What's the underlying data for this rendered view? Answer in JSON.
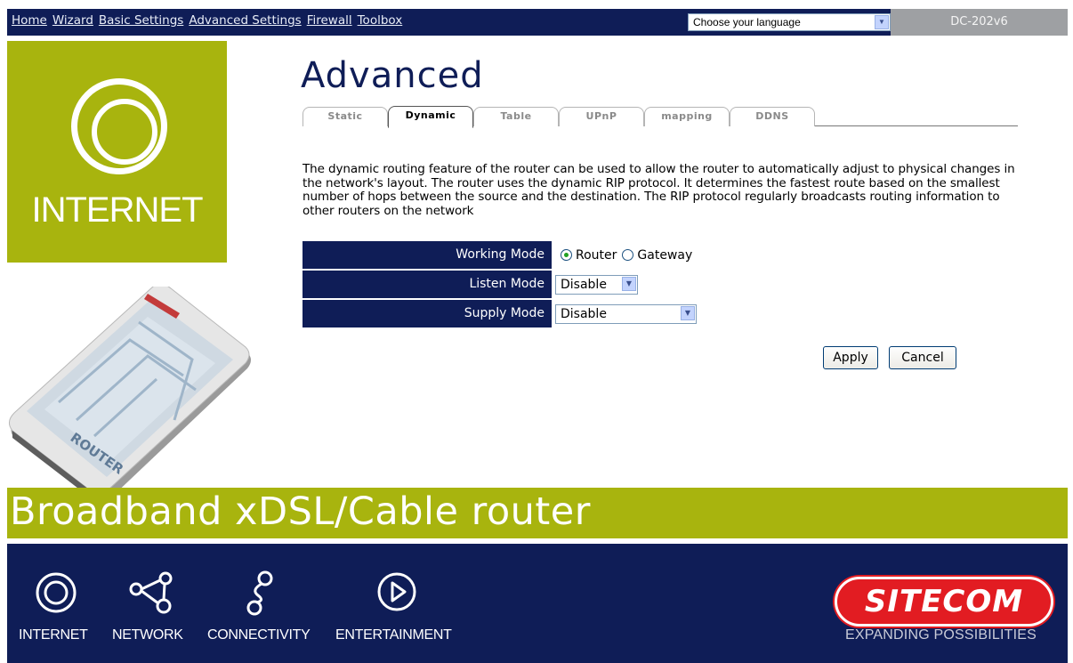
{
  "nav": {
    "items": [
      "Home",
      "Wizard",
      "Basic Settings",
      "Advanced Settings",
      "Firewall",
      "Toolbox"
    ]
  },
  "language_select": {
    "value": "Choose your language"
  },
  "model_name": "DC-202v6",
  "left_panel": {
    "label": "INTERNET",
    "router_text": "ROUTER"
  },
  "page_title": "Advanced",
  "tabs": [
    {
      "label": "Static",
      "active": false
    },
    {
      "label": "Dynamic",
      "active": true
    },
    {
      "label": "Table",
      "active": false
    },
    {
      "label": "UPnP",
      "active": false
    },
    {
      "label": "mapping",
      "active": false
    },
    {
      "label": "DDNS",
      "active": false
    }
  ],
  "description": "The dynamic routing feature of the router can be used to allow the router to automatically adjust to physical changes in the network's layout. The router uses the dynamic RIP protocol. It determines the fastest route based on the smallest number of hops between the source and the destination. The RIP protocol regularly broadcasts routing information to other routers on the network",
  "form": {
    "working_mode": {
      "label": "Working Mode",
      "options": [
        "Router",
        "Gateway"
      ],
      "selected": "Router"
    },
    "listen_mode": {
      "label": "Listen Mode",
      "value": "Disable"
    },
    "supply_mode": {
      "label": "Supply Mode",
      "value": "Disable"
    }
  },
  "buttons": {
    "apply": "Apply",
    "cancel": "Cancel"
  },
  "banner": "Broadband xDSL/Cable router",
  "footer": {
    "items": [
      {
        "label": "INTERNET",
        "icon": "internet-icon"
      },
      {
        "label": "NETWORK",
        "icon": "network-icon"
      },
      {
        "label": "CONNECTIVITY",
        "icon": "connectivity-icon"
      },
      {
        "label": "ENTERTAINMENT",
        "icon": "entertainment-icon"
      }
    ],
    "brand": "SITECOM",
    "tagline": "EXPANDING POSSIBILITIES"
  },
  "colors": {
    "navy": "#0f1d57",
    "olive": "#a8b40e",
    "sitecom_red": "#e21c22",
    "model_gray": "#9ea0a3"
  }
}
